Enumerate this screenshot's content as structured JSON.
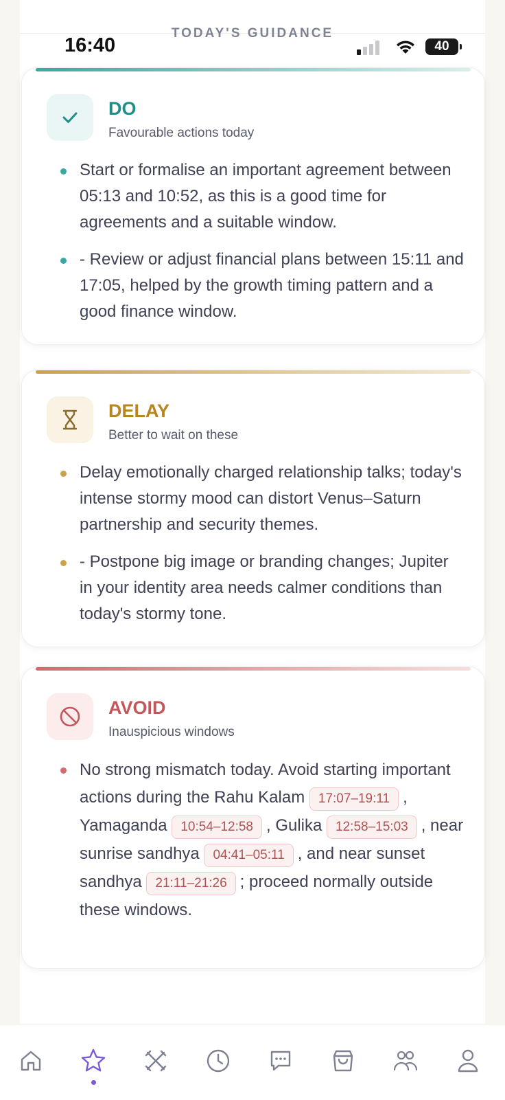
{
  "status_bar": {
    "time": "16:40",
    "battery": "40"
  },
  "header": {
    "title": "TODAY'S GUIDANCE"
  },
  "colors": {
    "do": "#1e8f86",
    "delay": "#b9851f",
    "avoid": "#c4575c",
    "nav_active": "#7c5cd6"
  },
  "do_card": {
    "title": "DO",
    "subtitle": "Favourable actions today",
    "items": [
      "Start or formalise an important agreement between 05:13 and 10:52, as this is a good time for agreements and a suitable window.",
      "- Review or adjust financial plans between 15:11 and 17:05, helped by the growth timing pattern and a good finance window."
    ]
  },
  "delay_card": {
    "title": "DELAY",
    "subtitle": "Better to wait on these",
    "items": [
      "Delay emotionally charged relationship talks; today's intense stormy mood can distort Venus–Saturn partnership and security themes.",
      "- Postpone big image or branding changes; Jupiter in your identity area needs calmer conditions than today's stormy tone."
    ]
  },
  "avoid_card": {
    "title": "AVOID",
    "subtitle": "Inauspicious windows",
    "intro": "No strong mismatch today. Avoid starting important actions during the Rahu Kalam",
    "rahu_kalam": "17:07–19:11",
    "sep1": ", Yamaganda",
    "yamaganda": "10:54–12:58",
    "sep2": ", Gulika",
    "gulika": "12:58–15:03",
    "sep3": ", near sunrise sandhya",
    "sunrise_sandhya": "04:41–05:11",
    "sep4": ", and near sunset sandhya",
    "sunset_sandhya": "21:11–21:26",
    "outro": "; proceed normally outside these windows."
  },
  "nav": {
    "icons": [
      "home-icon",
      "star-icon",
      "crossed-tools-icon",
      "clock-icon",
      "chat-icon",
      "shopping-bag-icon",
      "users-icon",
      "profile-icon"
    ],
    "active": "star-icon"
  }
}
